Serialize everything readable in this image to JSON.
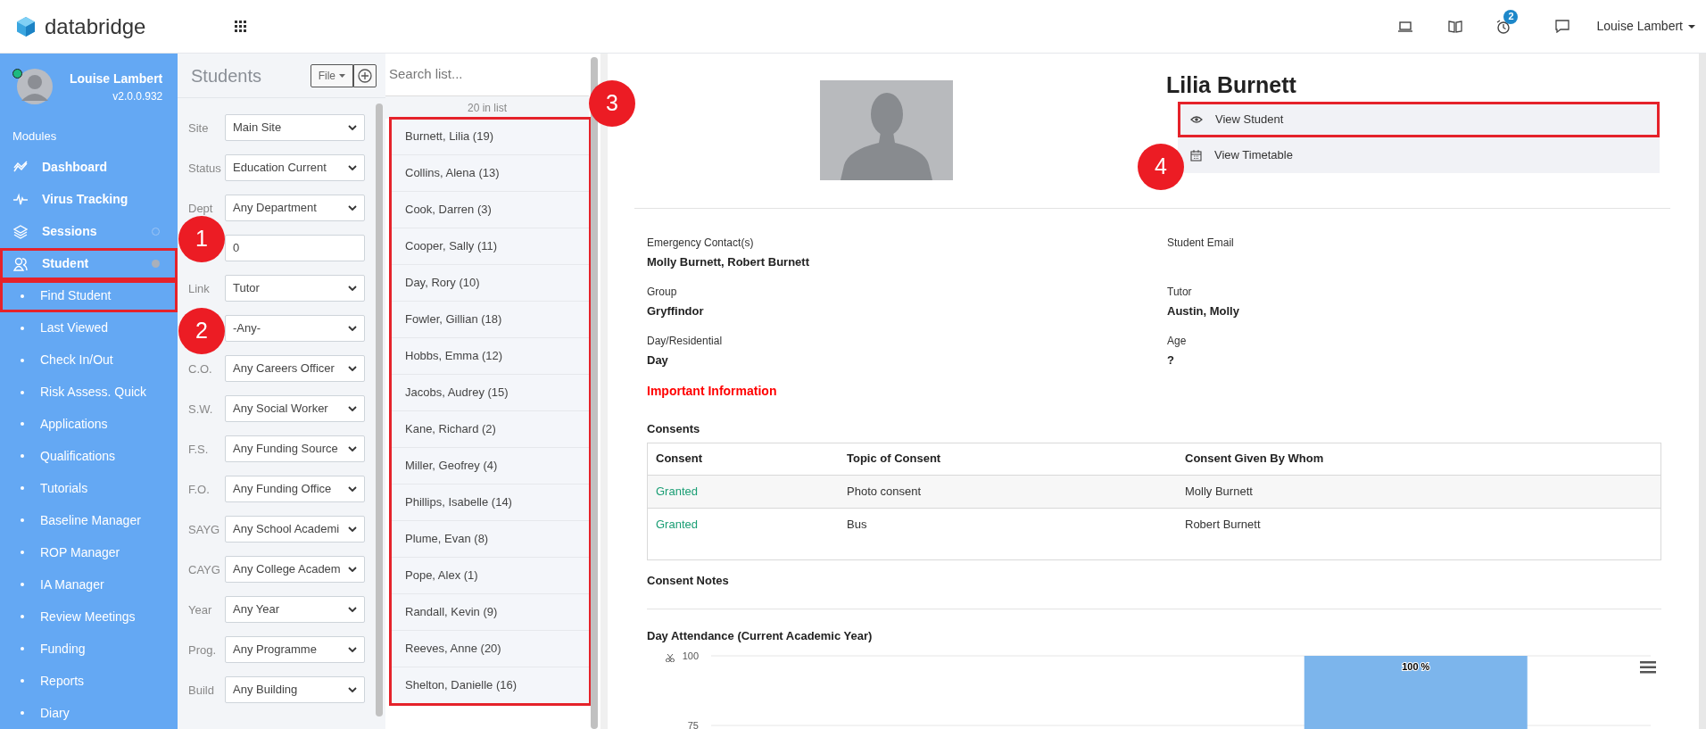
{
  "top_bar": {
    "logo_text": "databridge",
    "notification_count": "2",
    "user_menu": "Louise Lambert"
  },
  "sidebar": {
    "user_name": "Louise Lambert",
    "version": "v2.0.0.932",
    "online": true,
    "section_label": "Modules",
    "items": [
      {
        "kind": "link",
        "label": "Dashboard",
        "highlighted": false
      },
      {
        "kind": "link",
        "label": "Virus Tracking",
        "highlighted": false
      },
      {
        "kind": "group",
        "label": "Sessions",
        "expanded": false,
        "highlighted": false
      },
      {
        "kind": "group",
        "label": "Student",
        "expanded": true,
        "highlighted": true
      },
      {
        "kind": "sub",
        "label": "Find Student",
        "highlighted": true
      },
      {
        "kind": "sub",
        "label": "Last Viewed",
        "highlighted": false
      },
      {
        "kind": "sub",
        "label": "Check In/Out",
        "highlighted": false
      },
      {
        "kind": "sub",
        "label": "Risk Assess. Quick",
        "highlighted": false
      },
      {
        "kind": "sub",
        "label": "Applications",
        "highlighted": false
      },
      {
        "kind": "sub",
        "label": "Qualifications",
        "highlighted": false
      },
      {
        "kind": "sub",
        "label": "Tutorials",
        "highlighted": false
      },
      {
        "kind": "sub",
        "label": "Baseline Manager",
        "highlighted": false
      },
      {
        "kind": "sub",
        "label": "ROP Manager",
        "highlighted": false
      },
      {
        "kind": "sub",
        "label": "IA Manager",
        "highlighted": false
      },
      {
        "kind": "sub",
        "label": "Review Meetings",
        "highlighted": false
      },
      {
        "kind": "sub",
        "label": "Funding",
        "highlighted": false
      },
      {
        "kind": "sub",
        "label": "Reports",
        "highlighted": false
      },
      {
        "kind": "sub",
        "label": "Diary",
        "highlighted": false
      }
    ]
  },
  "filters": {
    "title": "Students",
    "file_button": "File",
    "fields": [
      {
        "kind": "select",
        "label": "Site",
        "value": "Main Site"
      },
      {
        "kind": "select",
        "label": "Status",
        "value": "Education Current"
      },
      {
        "kind": "select",
        "label": "Dept",
        "value": "Any Department"
      },
      {
        "kind": "text",
        "value": "0"
      },
      {
        "kind": "select",
        "label": "Link",
        "value": "Tutor"
      },
      {
        "kind": "select",
        "value": "-Any-"
      },
      {
        "kind": "select",
        "label": "C.O.",
        "value": "Any Careers Officer"
      },
      {
        "kind": "select",
        "label": "S.W.",
        "value": "Any Social Worker"
      },
      {
        "kind": "select",
        "label": "F.S.",
        "value": "Any Funding Source"
      },
      {
        "kind": "select",
        "label": "F.O.",
        "value": "Any Funding Office"
      },
      {
        "kind": "select",
        "label": "SAYG",
        "value": "Any School Academi"
      },
      {
        "kind": "select",
        "label": "CAYG",
        "value": "Any College Academ"
      },
      {
        "kind": "select",
        "label": "Year",
        "value": "Any Year"
      },
      {
        "kind": "select",
        "label": "Prog.",
        "value": "Any Programme"
      },
      {
        "kind": "select",
        "label": "Build",
        "value": "Any Building"
      }
    ]
  },
  "student_list": {
    "placeholder": "Search list...",
    "count": "20 in list",
    "highlighted": true,
    "items": [
      "Burnett, Lilia (19)",
      "Collins, Alena (13)",
      "Cook, Darren (3)",
      "Cooper, Sally (11)",
      "Day, Rory (10)",
      "Fowler, Gillian (18)",
      "Hobbs, Emma (12)",
      "Jacobs, Audrey (15)",
      "Kane, Richard (2)",
      "Miller, Geofrey (4)",
      "Phillips, Isabelle (14)",
      "Plume, Evan (8)",
      "Pope, Alex (1)",
      "Randall, Kevin (9)",
      "Reeves, Anne (20)",
      "Shelton, Danielle (16)"
    ]
  },
  "student": {
    "name": "Lilia Burnett",
    "actions": [
      {
        "kind": "view",
        "label": "View Student",
        "highlighted": true
      },
      {
        "kind": "timetable",
        "label": "View Timetable",
        "highlighted": false
      }
    ],
    "fields": [
      {
        "label": "Emergency Contact(s)",
        "value": "Molly Burnett, Robert Burnett"
      },
      {
        "label": "Student Email"
      },
      {
        "label": "Group",
        "value": "Gryffindor"
      },
      {
        "label": "Tutor",
        "value": "Austin, Molly"
      },
      {
        "label": "Day/Residential",
        "value": "Day"
      },
      {
        "label": "Age",
        "value": "?"
      }
    ],
    "important_heading": "Important Information",
    "consents": {
      "title": "Consents",
      "columns": [
        "Consent",
        "Topic of Consent",
        "Consent Given By Whom"
      ],
      "rows": [
        {
          "status": "Granted",
          "topic": "Photo consent",
          "given_by": "Molly Burnett"
        },
        {
          "status": "Granted",
          "topic": "Bus",
          "given_by": "Robert Burnett"
        }
      ]
    },
    "consent_notes_title": "Consent Notes",
    "attendance": {
      "title": "Day Attendance (Current Academic Year)",
      "chart_data": {
        "type": "bar",
        "values": [
          null,
          100
        ],
        "ylim": [
          70,
          100
        ],
        "yticks": [
          75,
          100
        ],
        "value_labels": [
          null,
          "100 %"
        ]
      }
    }
  },
  "annotations": [
    {
      "number": "1"
    },
    {
      "number": "2"
    },
    {
      "number": "3"
    },
    {
      "number": "4"
    }
  ]
}
